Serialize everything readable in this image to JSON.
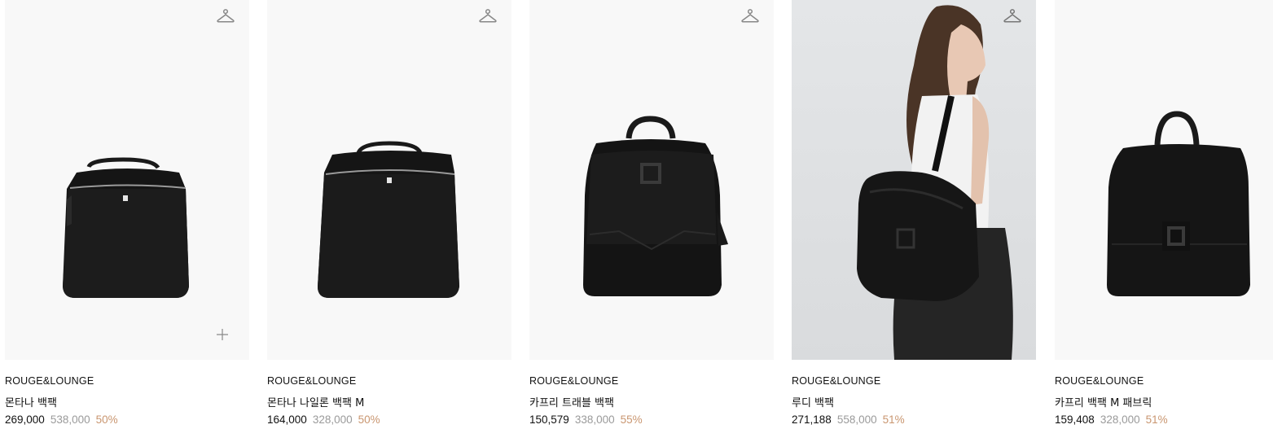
{
  "products": [
    {
      "brand": "ROUGE&LOUNGE",
      "name": "몬타나 백팩",
      "price": "269,000",
      "original_price": "538,000",
      "discount": "50%",
      "image": "black-pebbled-leather-backpack",
      "icons": [
        "hanger-icon",
        "plus-icon"
      ]
    },
    {
      "brand": "ROUGE&LOUNGE",
      "name": "몬타나 나일론 백팩 M",
      "price": "164,000",
      "original_price": "328,000",
      "discount": "50%",
      "image": "black-nylon-backpack",
      "icons": [
        "hanger-icon"
      ]
    },
    {
      "brand": "ROUGE&LOUNGE",
      "name": "카프리 트래블 백팩",
      "price": "150,579",
      "original_price": "338,000",
      "discount": "55%",
      "image": "black-travel-backpack",
      "icons": [
        "hanger-icon"
      ]
    },
    {
      "brand": "ROUGE&LOUNGE",
      "name": "루디 백팩",
      "price": "271,188",
      "original_price": "558,000",
      "discount": "51%",
      "image": "model-wearing-black-backpack",
      "icons": [
        "hanger-icon"
      ]
    },
    {
      "brand": "ROUGE&LOUNGE",
      "name": "카프리 백팩 M 패브릭",
      "price": "159,408",
      "original_price": "328,000",
      "discount": "51%",
      "image": "black-fabric-backpack",
      "icons": [
        "hanger-icon"
      ]
    }
  ],
  "colors": {
    "discount": "#c99670",
    "original_price": "#9a9a9a",
    "image_bg": "#f8f8f8"
  }
}
